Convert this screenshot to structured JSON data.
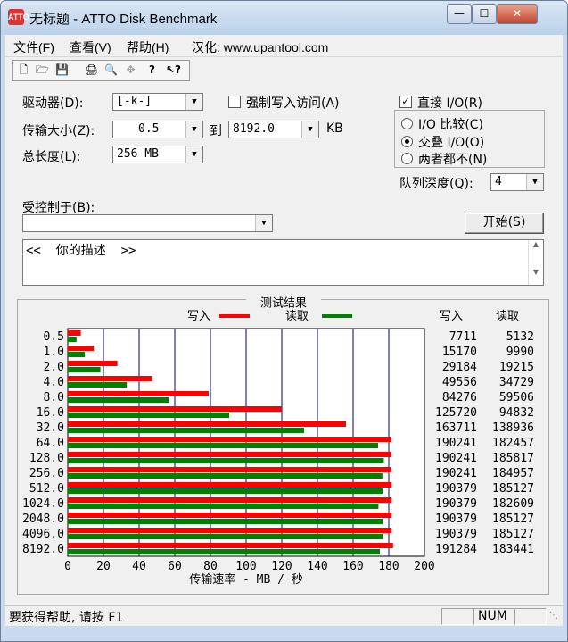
{
  "window": {
    "title": "无标题 - ATTO Disk Benchmark",
    "icon_text": "ATTO",
    "controls": [
      "minimize-icon",
      "maximize-icon",
      "close-icon"
    ]
  },
  "menu": [
    {
      "label": "文件(F)"
    },
    {
      "label": "查看(V)"
    },
    {
      "label": "帮助(H)"
    },
    {
      "label": "汉化: www.upantool.com"
    }
  ],
  "toolbar": [
    "new-icon",
    "open-icon",
    "save-icon",
    "print-icon",
    "print-preview-icon",
    "move-icon",
    "help-icon",
    "context-help-icon"
  ],
  "form": {
    "drive_label": "驱动器(D):",
    "drive_value": "[-k-]",
    "force_write_label": "强制写入访问(A)",
    "force_write_checked": false,
    "direct_io_label": "直接 I/O(R)",
    "direct_io_checked": true,
    "transfer_label": "传输大小(Z):",
    "transfer_from": "0.5",
    "to_label": "到",
    "transfer_to": "8192.0",
    "kb_label": "KB",
    "total_label": "总长度(L):",
    "total_value": "256 MB",
    "io_options": [
      {
        "label": "I/O 比较(C)",
        "selected": false
      },
      {
        "label": "交叠 I/O(O)",
        "selected": true
      },
      {
        "label": "两者都不(N)",
        "selected": false
      }
    ],
    "queue_label": "队列深度(Q):",
    "queue_value": "4",
    "controlled_label": "受控制于(B):",
    "controlled_value": "",
    "start_button": "开始(S)",
    "description": "<<  你的描述  >>"
  },
  "chart_data": {
    "type": "bar",
    "orientation": "horizontal",
    "title": "测试结果",
    "xlabel": "传输速率 - MB / 秒",
    "xlim": [
      0,
      200
    ],
    "xticks": [
      0,
      20,
      40,
      60,
      80,
      100,
      120,
      140,
      160,
      180,
      200
    ],
    "categories": [
      "0.5",
      "1.0",
      "2.0",
      "4.0",
      "8.0",
      "16.0",
      "32.0",
      "64.0",
      "128.0",
      "256.0",
      "512.0",
      "1024.0",
      "2048.0",
      "4096.0",
      "8192.0"
    ],
    "series": [
      {
        "name": "写入",
        "color": "#ff0000",
        "values": [
          7.3,
          14.5,
          27.8,
          47.3,
          79.0,
          120.0,
          156.0,
          181.4,
          181.4,
          181.4,
          181.6,
          181.6,
          181.6,
          181.6,
          182.4
        ]
      },
      {
        "name": "读取",
        "color": "#008000",
        "values": [
          4.9,
          9.5,
          18.3,
          33.1,
          56.8,
          90.5,
          132.5,
          174.0,
          177.2,
          176.4,
          176.6,
          174.2,
          176.6,
          176.6,
          175.0
        ]
      }
    ],
    "table_headers": [
      "写入",
      "读取"
    ],
    "write_kbps": [
      "7711",
      "15170",
      "29184",
      "49556",
      "84276",
      "125720",
      "163711",
      "190241",
      "190241",
      "190241",
      "190379",
      "190379",
      "190379",
      "190379",
      "191284"
    ],
    "read_kbps": [
      "5132",
      "9990",
      "19215",
      "34729",
      "59506",
      "94832",
      "138936",
      "182457",
      "185817",
      "184957",
      "185127",
      "182609",
      "185127",
      "185127",
      "183441"
    ],
    "grid": true
  },
  "status": {
    "help_text": "要获得帮助, 请按 F1",
    "num": "NUM"
  }
}
